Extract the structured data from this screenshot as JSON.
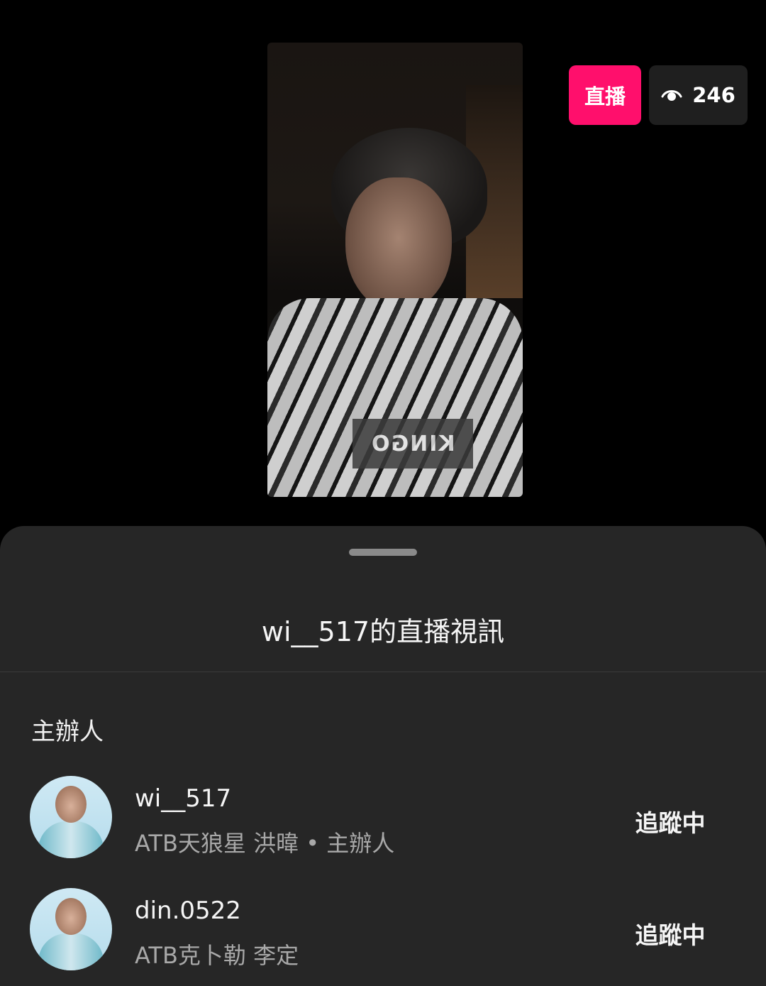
{
  "video": {
    "shirt_text": "KINGO"
  },
  "badges": {
    "live_label": "直播",
    "viewer_icon": "eye-icon",
    "viewer_count": "246",
    "live_color": "#ff0f6c"
  },
  "sheet": {
    "title": "wi__517的直播視訊",
    "section_label": "主辦人",
    "people": [
      {
        "username": "wi__517",
        "subtitle": "ATB天狼星 洪暐 • 主辦人",
        "follow_label": "追蹤中"
      },
      {
        "username": "din.0522",
        "subtitle": "ATB克卜勒 李定",
        "follow_label": "追蹤中"
      }
    ]
  }
}
